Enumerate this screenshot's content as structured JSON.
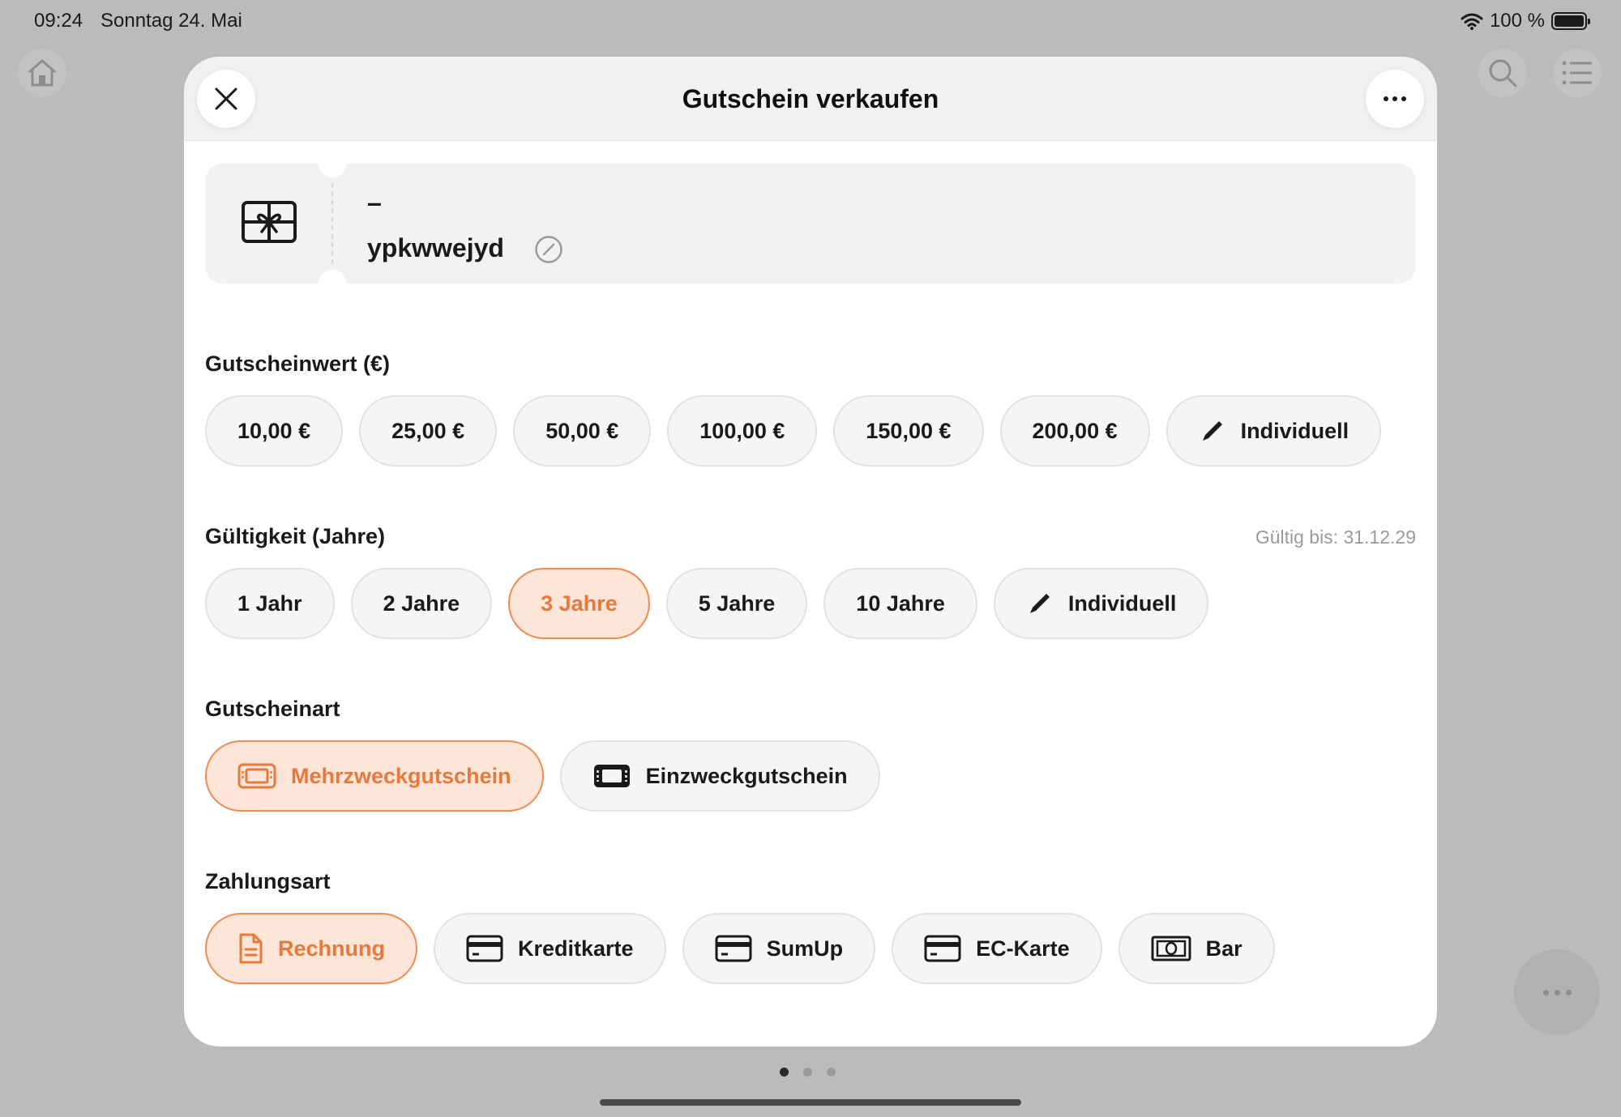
{
  "status_bar": {
    "time": "09:24",
    "date": "Sonntag 24. Mai",
    "battery": "100 %"
  },
  "modal": {
    "title": "Gutschein verkaufen"
  },
  "voucher": {
    "dash": "–",
    "code": "ypkwwejyd"
  },
  "value_section": {
    "label": "Gutscheinwert (€)",
    "options": [
      "10,00 €",
      "25,00 €",
      "50,00 €",
      "100,00 €",
      "150,00 €",
      "200,00 €"
    ],
    "custom_label": "Individuell"
  },
  "validity_section": {
    "label": "Gültigkeit (Jahre)",
    "valid_until": "Gültig bis: 31.12.29",
    "options": [
      "1 Jahr",
      "2 Jahre",
      "3 Jahre",
      "5 Jahre",
      "10 Jahre"
    ],
    "selected": "3 Jahre",
    "custom_label": "Individuell"
  },
  "type_section": {
    "label": "Gutscheinart",
    "options": [
      "Mehrzweckgutschein",
      "Einzweckgutschein"
    ],
    "selected": "Mehrzweckgutschein"
  },
  "payment_section": {
    "label": "Zahlungsart",
    "options": [
      "Rechnung",
      "Kreditkarte",
      "SumUp",
      "EC-Karte",
      "Bar"
    ],
    "selected": "Rechnung"
  },
  "colors": {
    "accent": "#e67a3e",
    "accent_bg": "#fde5d7",
    "accent_border": "#ef8a55",
    "chip_bg": "#f6f5f4",
    "backdrop": "#bdbbb9"
  },
  "pager": {
    "pages": 3,
    "current": 1
  }
}
